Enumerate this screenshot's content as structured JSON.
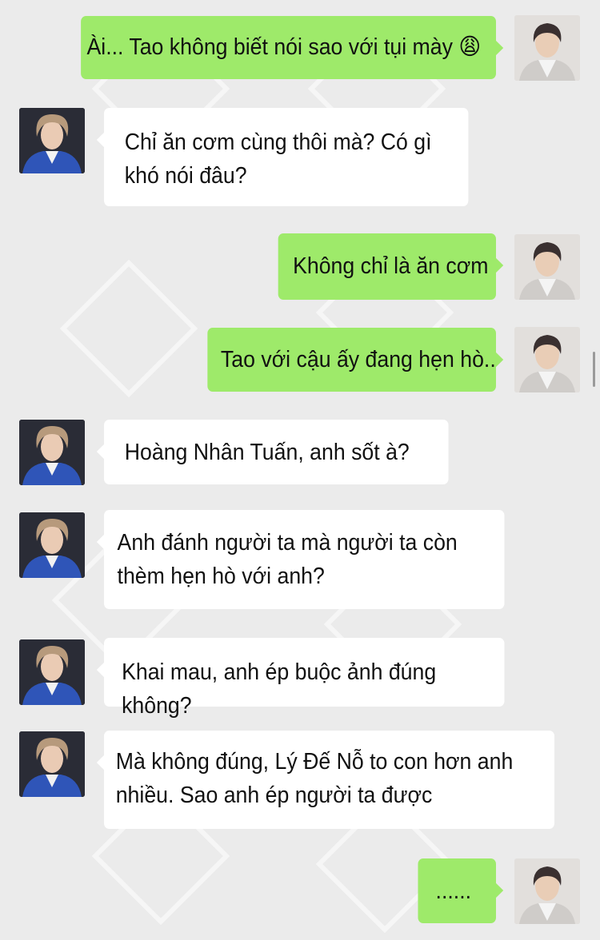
{
  "theme": {
    "background": "#ebebeb",
    "me_bubble": "#9eea6a",
    "them_bubble": "#ffffff"
  },
  "messages": [
    {
      "sender": "me",
      "text": "Ài... Tao không biết nói sao với tụi mày 😩"
    },
    {
      "sender": "them",
      "text": "Chỉ ăn cơm cùng thôi mà? Có gì khó nói đâu?"
    },
    {
      "sender": "me",
      "text": "Không chỉ là ăn cơm"
    },
    {
      "sender": "me",
      "text": "Tao với cậu ấy đang hẹn hò.."
    },
    {
      "sender": "them",
      "text": "Hoàng Nhân Tuấn, anh sốt à?"
    },
    {
      "sender": "them",
      "text": "Anh đánh người ta mà người ta còn thèm hẹn hò với anh?"
    },
    {
      "sender": "them",
      "text": "Khai mau, anh ép buộc ảnh đúng không?"
    },
    {
      "sender": "them",
      "text": "Mà không đúng, Lý Đế Nỗ to con hơn anh nhiều. Sao anh ép người ta được"
    },
    {
      "sender": "me",
      "text": "......"
    }
  ]
}
